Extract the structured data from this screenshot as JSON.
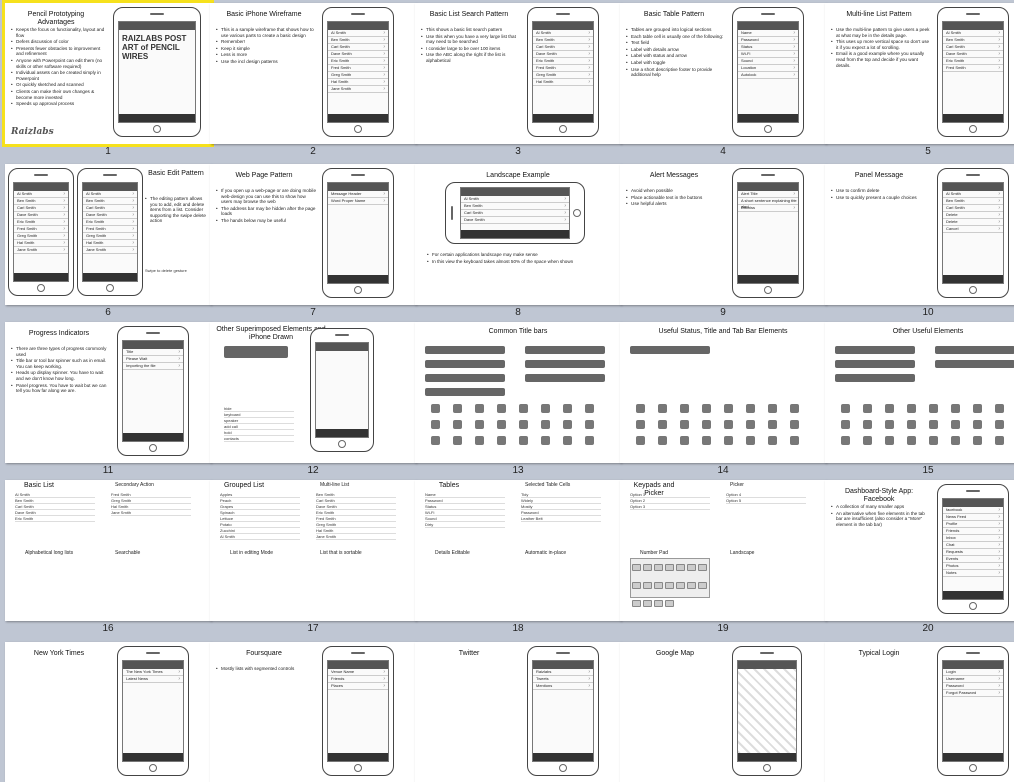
{
  "slides": [
    {
      "num": "1",
      "title": "Pencil Prototyping Advantages",
      "bullets": [
        "Keeps the focus on functionality, layout and flow",
        "Defers discussion of color",
        "Presents fewer obstacles to improvement and refinement",
        "Anyone with Powerpoint can edit them (no skills or other software required)",
        "Individual assets can be created simply in Powerpoint",
        "Or quickly sketched and scanned",
        "Clients can make their own changes & become more invested",
        "Speeds up approval process"
      ],
      "logo": "Raizlabs",
      "art": "RAIZLABS POST ART of PENCIL WIRES"
    },
    {
      "num": "2",
      "title": "Basic iPhone Wireframe",
      "bullets": [
        "This is a sample wireframe that shows how to use various parts to create a basic design",
        "Remember!",
        "Keep it simple",
        "Less is more",
        "Use the incl design patterns"
      ],
      "rows": [
        "Al Smith",
        "Ben Smith",
        "Carl Smith",
        "Dave Smith",
        "Eric Smith",
        "Fred Smith",
        "Greg Smith",
        "Hal Smith",
        "Jane Smith"
      ],
      "callout": "Gotta Rule"
    },
    {
      "num": "3",
      "title": "Basic List Search Pattern",
      "bullets": [
        "This shows a basic list search pattern",
        "Use this when you have a very large list that may need to be searched",
        "I consider large to be over 100 items",
        "Use the ABC along the right if the list is alphabetical"
      ],
      "rows": [
        "Al Smith",
        "Ben Smith",
        "Carl Smith",
        "Dave Smith",
        "Eric Smith",
        "Fred Smith",
        "Greg Smith",
        "Hal Smith"
      ]
    },
    {
      "num": "4",
      "title": "Basic Table Pattern",
      "bullets": [
        "Tables are grouped into logical sections",
        "Each table cell is usually one of the following:",
        "Text field",
        "Label with details arrow",
        "Label with status and arrow",
        "Label with toggle",
        "Use a short descriptive footer to provide additional help"
      ],
      "rows": [
        "Name",
        "Password",
        "Status",
        "Wi-Fi",
        "Sound",
        "Location",
        "Autolock"
      ]
    },
    {
      "num": "5",
      "title": "Multi-line List Pattern",
      "bullets": [
        "Use the multi-line pattern to give users a peek at what may be in the details page.",
        "This uses up more vertical space so don't use it if you expect a lot of scrolling.",
        "Email is a good example where you usually read from the top and decide if you want details."
      ],
      "rows": [
        "Al Smith",
        "Ben Smith",
        "Carl Smith",
        "Dave Smith",
        "Eric Smith",
        "Fred Smith"
      ]
    },
    {
      "num": "6",
      "title": "Basic Edit Pattern",
      "bullets": [
        "The editing pattern allows you to add, edit and delete items from a list. Consider supporting the swipe delete action"
      ],
      "rows": [
        "Al Smith",
        "Ben Smith",
        "Carl Smith",
        "Dave Smith",
        "Eric Smith",
        "Fred Smith",
        "Greg Smith",
        "Hal Smith",
        "Jane Smith"
      ],
      "caption": "Swipe to delete gesture"
    },
    {
      "num": "7",
      "title": "Web Page Pattern",
      "bullets": [
        "If you open up a web-page or are doing mobile web-design you can use this to show how users may browse the web",
        "The address bar may be hidden after the page loads",
        "The hands below may be useful"
      ],
      "rows": [
        "Message Header",
        "Word Proper Name"
      ]
    },
    {
      "num": "8",
      "title": "Landscape Example",
      "bullets": [
        "For certain applications landscape may make sense",
        "In this view the keyboard takes almost 50% of the space when shown"
      ],
      "rows": [
        "Al Smith",
        "Ben Smith",
        "Carl Smith",
        "Dave Smith"
      ]
    },
    {
      "num": "9",
      "title": "Alert Messages",
      "bullets": [
        "Avoid when possible",
        "Place actionable text in the buttons",
        "Use helpful alerts"
      ],
      "rows": [
        "Alert Title",
        "A short sentence explaining the alert",
        "Dismiss"
      ]
    },
    {
      "num": "10",
      "title": "Panel Message",
      "bullets": [
        "Use to confirm delete",
        "Use to quickly present a couple choices"
      ],
      "rows": [
        "Al Smith",
        "Ben Smith",
        "Carl Smith",
        "Delete",
        "Delete",
        "Cancel"
      ]
    },
    {
      "num": "11",
      "title": "Progress Indicators",
      "bullets": [
        "There are three types of progress commonly used",
        "Title bar or tool bar spinner such as in email. You can keep working.",
        "Heads up display spinner. You have to wait and we don't know how long.",
        "Panel progress. You have to wait but we can tell you how far along we are."
      ],
      "rows": [
        "Title",
        "Please Wait",
        "Importing the file"
      ]
    },
    {
      "num": "12",
      "title": "Other Superimposed Elements and iPhone Drawn",
      "bullets": [],
      "rows": [
        "hide",
        "keyboard",
        "speaker",
        "add call",
        "hold",
        "contacts"
      ]
    },
    {
      "num": "13",
      "title": "Common Title bars",
      "bullets": [],
      "rows": [
        "Basic List",
        "Edit Item",
        "View List",
        "Title Long Name",
        "Title",
        "New Object",
        "Title"
      ]
    },
    {
      "num": "14",
      "title": "Useful Status, Title and Tab Bar Elements",
      "bullets": [],
      "rows": [
        "Write a caption"
      ]
    },
    {
      "num": "15",
      "title": "Other Useful Elements",
      "bullets": [],
      "rows": [
        "Tooltip",
        "Cancel",
        "Save",
        "Button",
        "Button"
      ]
    },
    {
      "num": "16",
      "title": "Basic List",
      "bullets": [],
      "sections": [
        "Basic List",
        "Secondary Action",
        "Alphabetical long lists",
        "Searchable"
      ],
      "rows": [
        "Al Smith",
        "Ben Smith",
        "Carl Smith",
        "Dave Smith",
        "Eric Smith",
        "Fred Smith",
        "Greg Smith",
        "Hal Smith",
        "Jane Smith"
      ]
    },
    {
      "num": "17",
      "title": "Grouped List",
      "bullets": [],
      "sections": [
        "Grouped List",
        "Multi-line List",
        "List in editing Mode",
        "List that is sortable"
      ],
      "rows": [
        "Apples",
        "Peach",
        "Grapes",
        "Spinach",
        "Lettuce",
        "Potato",
        "Zucchini",
        "Al Smith",
        "Ben Smith",
        "Carl Smith",
        "Dave Smith",
        "Eric Smith",
        "Fred Smith",
        "Greg Smith",
        "Hal Smith",
        "Jane Smith"
      ]
    },
    {
      "num": "18",
      "title": "Tables",
      "bullets": [],
      "sections": [
        "Text Editable",
        "Selected Table Cells",
        "Details Editable",
        "Automatic in-place"
      ],
      "rows": [
        "Name",
        "Password",
        "Status",
        "Wi-Fi",
        "Sound",
        "Dirty",
        "Tidy",
        "Widely",
        "Mostly",
        "Password",
        "Leather Belt"
      ]
    },
    {
      "num": "19",
      "title": "Keypads and Picker",
      "bullets": [],
      "sections": [
        "Normal",
        "Picker",
        "Number Pad",
        "Landscape"
      ],
      "rows": [
        "Option 1",
        "Option 2",
        "Option 3",
        "Option 4",
        "Option 5"
      ]
    },
    {
      "num": "20",
      "title": "Dashboard-Style App: Facebook",
      "bullets": [
        "A collection of many smaller apps",
        "An alternative when five elements in the tab bar are insufficient (also consider a \"More\" element in the tab bar)"
      ],
      "rows": [
        "facebook",
        "News Feed",
        "Profile",
        "Friends",
        "Inbox",
        "Chat",
        "Requests",
        "Events",
        "Photos",
        "Notes"
      ]
    },
    {
      "num": "21",
      "title": "New York Times",
      "bullets": [],
      "rows": [
        "The New York Times",
        "Latest News"
      ]
    },
    {
      "num": "22",
      "title": "Foursquare",
      "bullets": [
        "Mostly lists with segmented controls"
      ],
      "rows": [
        "Venue Name",
        "Friends",
        "Places"
      ]
    },
    {
      "num": "23",
      "title": "Twitter",
      "bullets": [],
      "rows": [
        "Raizlabs",
        "Tweets",
        "Mentions"
      ]
    },
    {
      "num": "24",
      "title": "Google Map",
      "bullets": [],
      "rows": []
    },
    {
      "num": "25",
      "title": "Typical Login",
      "bullets": [],
      "rows": [
        "Login",
        "Username",
        "Password",
        "Forgot Password"
      ]
    }
  ],
  "selected_index": 0
}
